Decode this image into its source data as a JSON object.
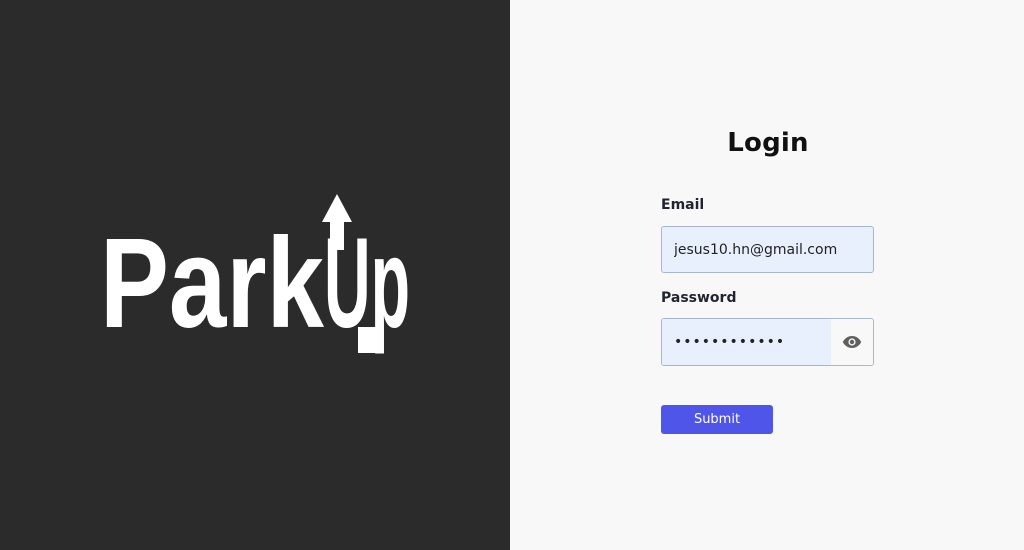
{
  "brand": {
    "logo_text": "ParkUp"
  },
  "login": {
    "title": "Login",
    "email_label": "Email",
    "email_value": "jesus10.hn@gmail.com",
    "password_label": "Password",
    "password_value": "••••••••••••",
    "show_password_icon": "eye-icon",
    "submit_label": "Submit"
  },
  "colors": {
    "brand_panel": "#2b2b2b",
    "form_panel": "#f8f8f8",
    "input_fill": "#e8f0fe",
    "accent": "#4f55e8"
  }
}
